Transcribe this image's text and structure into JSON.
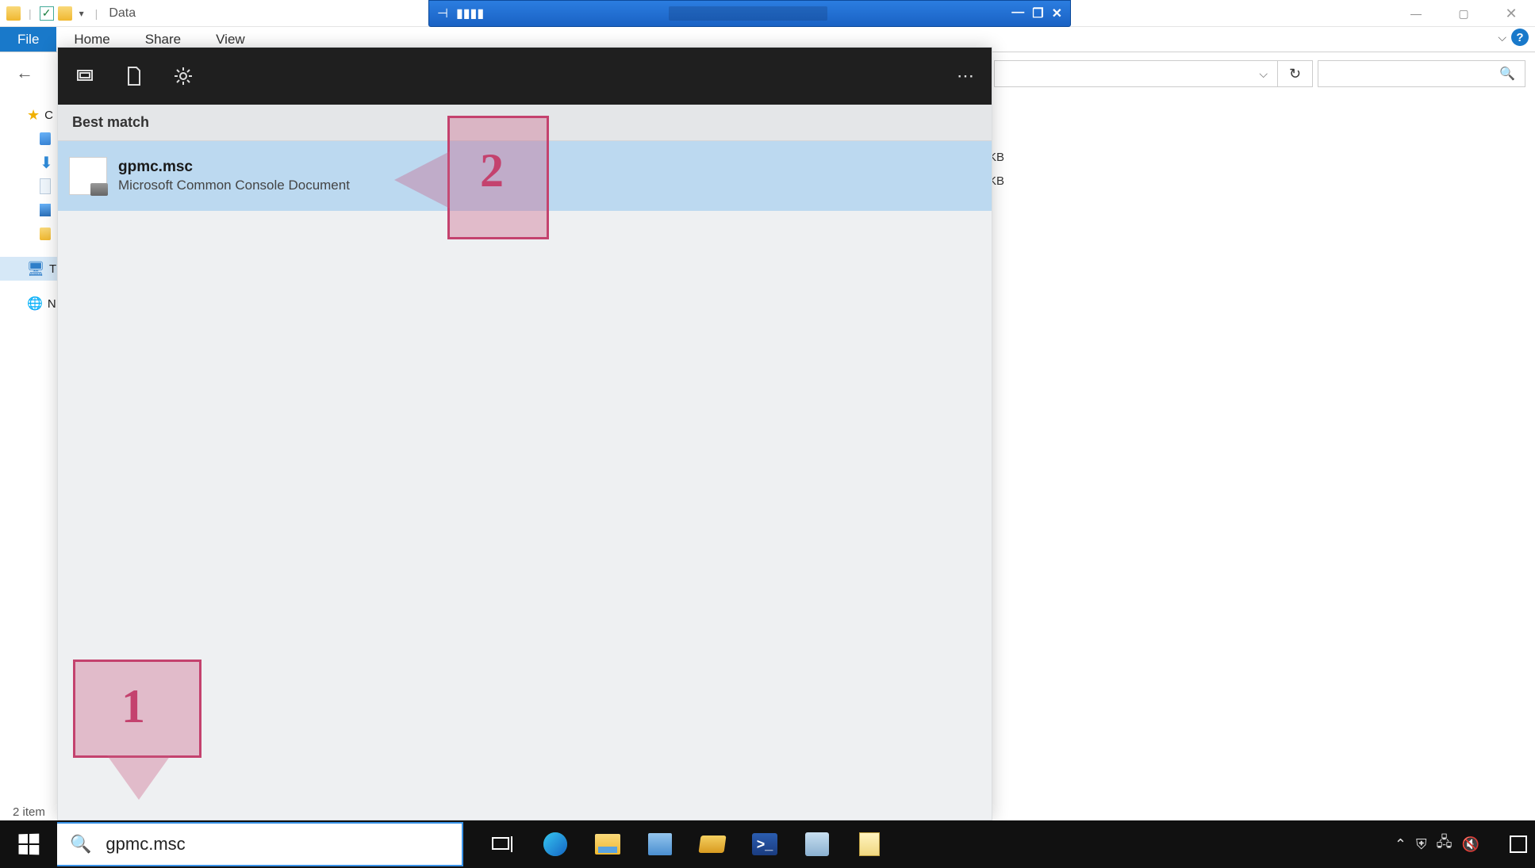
{
  "explorer": {
    "title": "Data",
    "ribbon": {
      "tabs": [
        "File",
        "Home",
        "Share",
        "View"
      ]
    },
    "status": "2 item",
    "files_size_hint_1": "KB",
    "files_size_hint_2": "KB",
    "help": "?"
  },
  "sidebar_labels": {
    "quick": "C",
    "thispc": "T",
    "network": "N"
  },
  "search_overlay": {
    "header": "Best match",
    "result": {
      "name": "gpmc.msc",
      "subtitle": "Microsoft Common Console Document"
    },
    "more": "⋯"
  },
  "callouts": {
    "one": "1",
    "two": "2"
  },
  "taskbar": {
    "search_value": "gpmc.msc",
    "clock_time": "",
    "clock_date": ""
  }
}
